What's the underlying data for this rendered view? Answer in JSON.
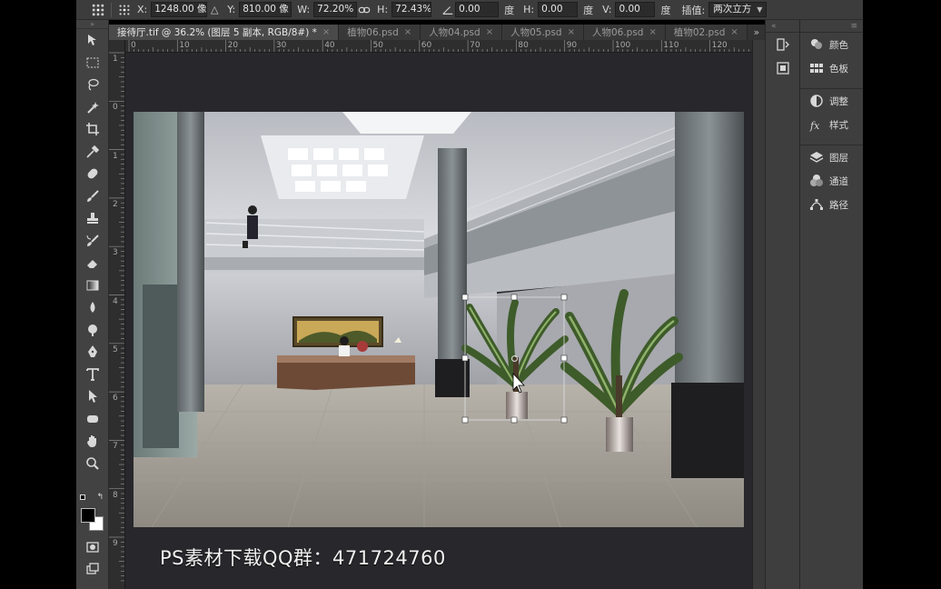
{
  "options_bar": {
    "x_label": "X:",
    "x_value": "1248.00 像",
    "y_label": "Y:",
    "y_value": "810.00 像",
    "w_label": "W:",
    "w_value": "72.20%",
    "h_label": "H:",
    "h_value": "72.43%",
    "angle_value": "0.00",
    "angle_unit": "度",
    "hskew_label": "H:",
    "hskew_value": "0.00",
    "hskew_unit": "度",
    "vskew_label": "V:",
    "vskew_value": "0.00",
    "vskew_unit": "度",
    "interp_label": "插值:",
    "interp_value": "两次立方"
  },
  "tabs": [
    {
      "label": "接待厅.tif @ 36.2% (图层 5 副本, RGB/8#) *",
      "active": true
    },
    {
      "label": "植物06.psd",
      "active": false
    },
    {
      "label": "人物04.psd",
      "active": false
    },
    {
      "label": "人物05.psd",
      "active": false
    },
    {
      "label": "人物06.psd",
      "active": false
    },
    {
      "label": "植物02.psd",
      "active": false
    }
  ],
  "tab_overflow": "»",
  "ruler_h": [
    "0",
    "10",
    "20",
    "30",
    "40",
    "50",
    "60",
    "70",
    "80",
    "90",
    "100",
    "110",
    "120"
  ],
  "ruler_v": [
    "1",
    "0",
    "1",
    "2",
    "3",
    "4",
    "5",
    "6",
    "7",
    "8",
    "9"
  ],
  "tools": [
    "move-icon",
    "marquee-icon",
    "lasso-icon",
    "magic-wand-icon",
    "crop-icon",
    "eyedropper-icon",
    "healing-brush-icon",
    "brush-icon",
    "clone-stamp-icon",
    "history-brush-icon",
    "eraser-icon",
    "gradient-icon",
    "blur-icon",
    "dodge-icon",
    "pen-icon",
    "type-icon",
    "path-selection-icon",
    "shape-icon",
    "hand-icon",
    "zoom-icon"
  ],
  "panels": {
    "group1": [
      {
        "label": "颜色",
        "icon": "color-icon"
      },
      {
        "label": "色板",
        "icon": "swatches-icon"
      }
    ],
    "group2": [
      {
        "label": "调整",
        "icon": "adjustments-icon"
      },
      {
        "label": "样式",
        "icon": "styles-icon"
      }
    ],
    "group3": [
      {
        "label": "图层",
        "icon": "layers-icon"
      },
      {
        "label": "通道",
        "icon": "channels-icon"
      },
      {
        "label": "路径",
        "icon": "paths-icon"
      }
    ]
  },
  "watermark": "PS素材下载QQ群：471724760",
  "colors": {
    "foreground": "#000000",
    "background": "#ffffff"
  }
}
